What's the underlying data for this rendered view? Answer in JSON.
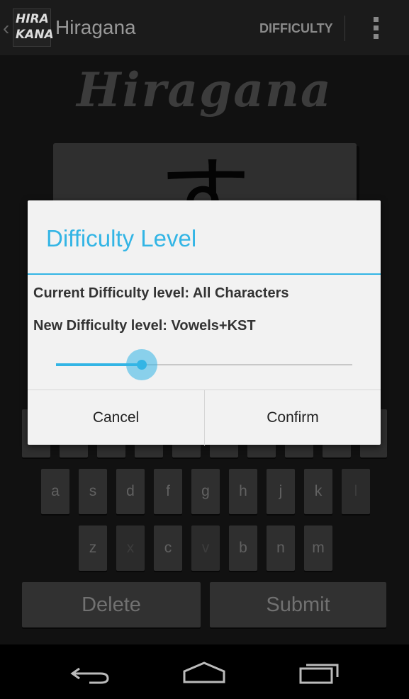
{
  "action_bar": {
    "logo_lines": [
      "HIRA",
      "KANA"
    ],
    "title": "Hiragana",
    "difficulty_action": "DIFFICULTY",
    "overflow_icon": "overflow-menu-icon"
  },
  "main": {
    "logo_text": "Hiragana",
    "current_character": "す",
    "keyboard_rows": [
      [
        "a",
        "s",
        "d",
        "f",
        "g",
        "h",
        "j",
        "k",
        "l"
      ],
      [
        "z",
        "x",
        "c",
        "v",
        "b",
        "n",
        "m"
      ]
    ],
    "disabled_keys": [
      "x",
      "v",
      "l"
    ],
    "delete_label": "Delete",
    "submit_label": "Submit"
  },
  "dialog": {
    "title": "Difficulty Level",
    "current_level_text": "Current Difficulty level: All Characters",
    "new_level_text": "New Difficulty level: Vowels+KST",
    "slider_level_fraction": 0.29,
    "cancel_label": "Cancel",
    "confirm_label": "Confirm",
    "accent_color": "#33b5e5"
  },
  "navbar": {
    "icons": [
      "back-icon",
      "home-icon",
      "recent-apps-icon"
    ]
  }
}
